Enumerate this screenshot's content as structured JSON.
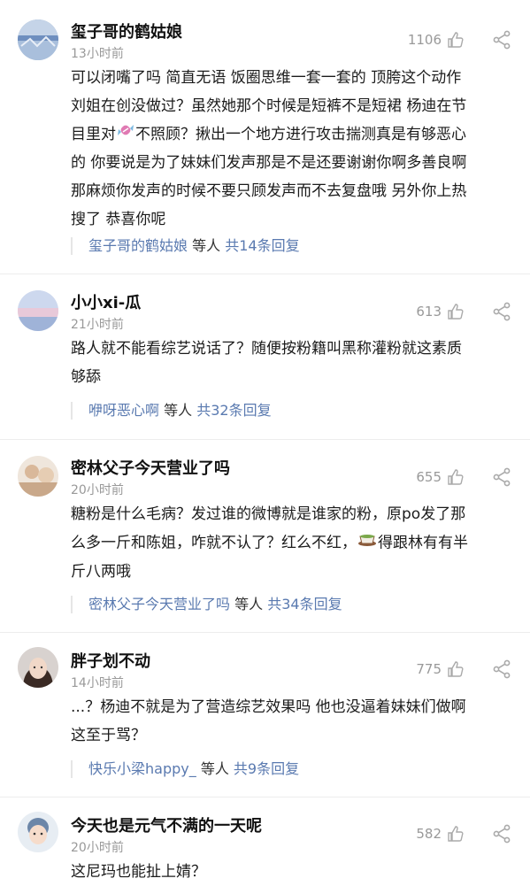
{
  "comments": [
    {
      "name": "玺子哥的鹤姑娘",
      "time": "13小时前",
      "likes": "1106",
      "body_lines": [
        "可以闭嘴了吗 简直无语 饭圈思维一套一套的 顶胯这个动作",
        "刘姐在创没做过？虽然她那个时候是短裤不是短裙 杨迪在节",
        "目里对",
        "不照顾？揪出一个地方进行攻击揣测真是有够恶心",
        "的 你要说是为了妹妹们发声那是不是还要谢谢你啊多善良啊",
        "那麻烦你发声的时候不要只顾发声而不去复盘哦 另外你上热",
        "搜了 恭喜你呢"
      ],
      "reply_user": "玺子哥的鹤姑娘",
      "reply_mid": " 等人 ",
      "reply_count": "共14条回复"
    },
    {
      "name": "小小xi-瓜",
      "time": "21小时前",
      "likes": "613",
      "body_lines": [
        "路人就不能看综艺说话了？随便按粉籍叫黑称灌粉就这素质",
        "够舔"
      ],
      "reply_user": "咿呀恶心啊",
      "reply_mid": " 等人 ",
      "reply_count": "共32条回复"
    },
    {
      "name": "密林父子今天营业了吗",
      "time": "20小时前",
      "likes": "655",
      "body_lines": [
        "糖粉是什么毛病？发过谁的微博就是谁家的粉，原po发了那",
        "么多一斤和陈姐，咋就不认了？红么不红，",
        "得跟林有有半",
        "斤八两哦"
      ],
      "reply_user": "密林父子今天营业了吗",
      "reply_mid": " 等人 ",
      "reply_count": "共34条回复"
    },
    {
      "name": "胖子划不动",
      "time": "14小时前",
      "likes": "775",
      "body_lines": [
        "...？杨迪不就是为了营造综艺效果吗 他也没逼着妹妹们做啊",
        "这至于骂？"
      ],
      "reply_user": "快乐小梁happy_",
      "reply_mid": " 等人 ",
      "reply_count": "共9条回复"
    },
    {
      "name": "今天也是元气不满的一天呢",
      "time": "20小时前",
      "likes": "582",
      "body_lines": [
        "这尼玛也能扯上婧？"
      ]
    }
  ],
  "icons": {
    "like": "thumbs-up-icon",
    "share": "share-icon",
    "candy": "candy-emoji-icon",
    "tea": "tea-emoji-icon"
  },
  "colors": {
    "link": "#5a7ab0",
    "meta": "#999999"
  }
}
